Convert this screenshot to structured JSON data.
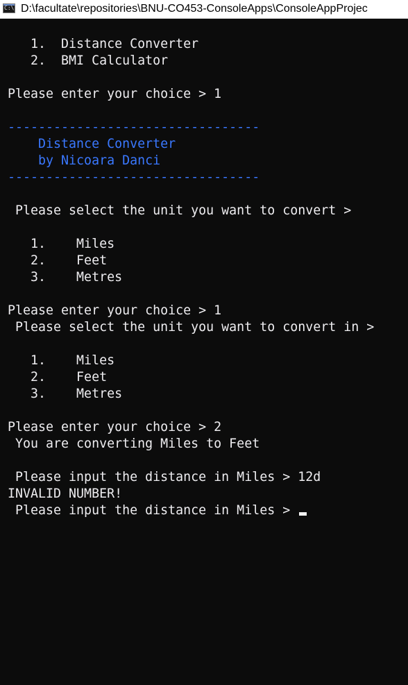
{
  "window": {
    "title": "D:\\facultate\\repositories\\BNU-CO453-ConsoleApps\\ConsoleAppProjec",
    "icon_label": "C:\\"
  },
  "console": {
    "lines": [
      {
        "text": "   1.  Distance Converter"
      },
      {
        "text": "   2.  BMI Calculator"
      },
      {
        "text": ""
      },
      {
        "text": "Please enter your choice > 1"
      },
      {
        "text": ""
      },
      {
        "text": "---------------------------------",
        "color": "blue"
      },
      {
        "text": "    Distance Converter",
        "color": "blue"
      },
      {
        "text": "    by Nicoara Danci",
        "color": "blue"
      },
      {
        "text": "---------------------------------",
        "color": "blue"
      },
      {
        "text": ""
      },
      {
        "text": " Please select the unit you want to convert >"
      },
      {
        "text": ""
      },
      {
        "text": "   1.    Miles"
      },
      {
        "text": "   2.    Feet"
      },
      {
        "text": "   3.    Metres"
      },
      {
        "text": ""
      },
      {
        "text": "Please enter your choice > 1"
      },
      {
        "text": " Please select the unit you want to convert in >"
      },
      {
        "text": ""
      },
      {
        "text": "   1.    Miles"
      },
      {
        "text": "   2.    Feet"
      },
      {
        "text": "   3.    Metres"
      },
      {
        "text": ""
      },
      {
        "text": "Please enter your choice > 2"
      },
      {
        "text": " You are converting Miles to Feet"
      },
      {
        "text": ""
      },
      {
        "text": " Please input the distance in Miles > 12d"
      },
      {
        "text": "INVALID NUMBER!"
      },
      {
        "text": " Please input the distance in Miles > ",
        "cursor": true
      }
    ]
  },
  "colors": {
    "background": "#0c0c0c",
    "foreground": "#eeedf0",
    "accent_blue": "#3a78ff"
  }
}
